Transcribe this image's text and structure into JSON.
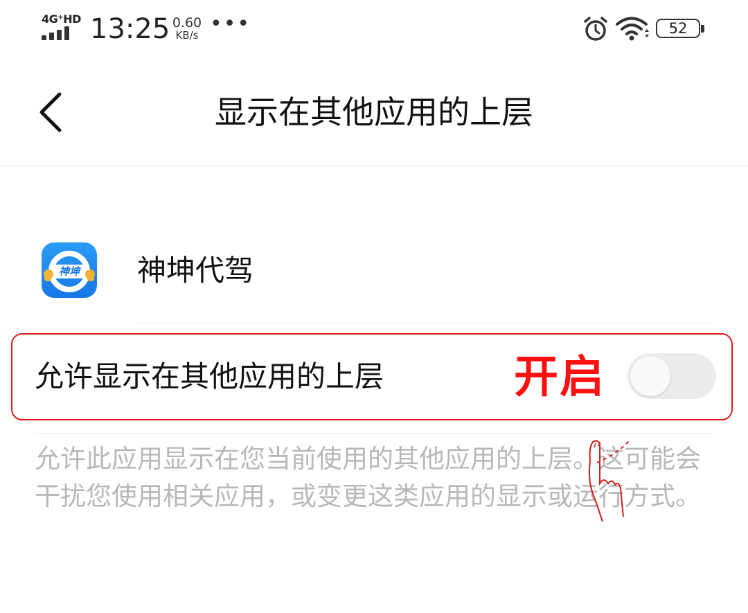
{
  "status_bar": {
    "network": "4G⁺HD",
    "signal_bars": 4,
    "time": "13:25",
    "speed_value": "0.60",
    "speed_unit": "KB/s",
    "more": "•••",
    "icons": [
      "alarm-icon",
      "wifi-icon",
      "battery-icon"
    ],
    "battery": "52"
  },
  "header": {
    "back_icon": "chevron-left-icon",
    "title": "显示在其他应用的上层"
  },
  "app": {
    "icon": "app-logo-icon",
    "icon_text": "神坤",
    "name": "神坤代驾"
  },
  "permission": {
    "label": "允许显示在其他应用的上层",
    "annotation": "开启",
    "toggle_state": "off",
    "description": "允许此应用显示在您当前使用的其他应用的上层。这可能会干扰您使用相关应用，或变更这类应用的显示或运行方式。"
  },
  "colors": {
    "annotation_red": "#ff1010",
    "highlight_border": "#e01b1b",
    "app_icon_blue": "#1e88f0",
    "toggle_off": "#ebebeb",
    "description_gray": "#b8b8b8"
  }
}
